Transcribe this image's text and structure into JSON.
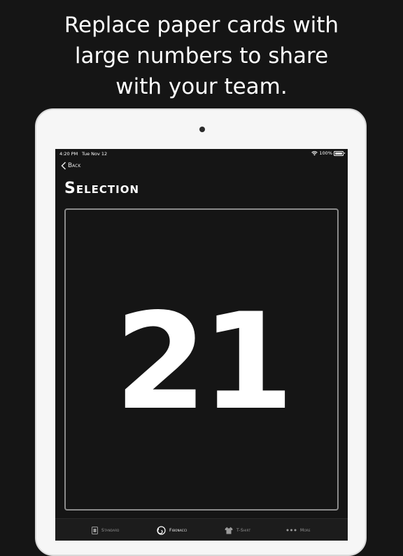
{
  "headline": {
    "line1": "Replace paper cards with",
    "line2": "large numbers to share",
    "line3": "with your team."
  },
  "status_bar": {
    "time": "4:20 PM",
    "date": "Tue Nov 12",
    "battery": "100%"
  },
  "nav": {
    "back_label": "Back"
  },
  "page": {
    "title": "Selection"
  },
  "card": {
    "value": "21"
  },
  "tabs": [
    {
      "label": "Standard",
      "icon": "cards-icon",
      "active": false
    },
    {
      "label": "Fibonacci",
      "icon": "fibonacci-spiral-icon",
      "active": true
    },
    {
      "label": "T-Shirt",
      "icon": "tshirt-icon",
      "active": false
    },
    {
      "label": "More",
      "icon": "more-dots-icon",
      "active": false
    }
  ]
}
